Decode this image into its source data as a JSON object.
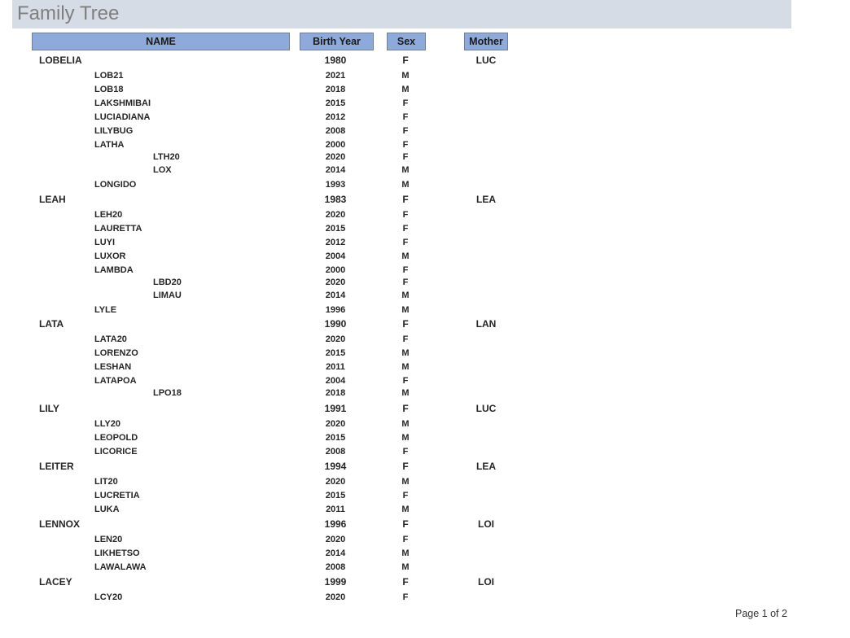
{
  "title": "Family Tree",
  "headers": {
    "name": "NAME",
    "birth_year": "Birth Year",
    "sex": "Sex",
    "mother": "Mother"
  },
  "rows": [
    {
      "level": 0,
      "name": "LOBELIA",
      "year": "1980",
      "sex": "F",
      "mother": "LUC"
    },
    {
      "level": 1,
      "name": "LOB21",
      "year": "2021",
      "sex": "M"
    },
    {
      "level": 1,
      "name": "LOB18",
      "year": "2018",
      "sex": "M"
    },
    {
      "level": 1,
      "name": "LAKSHMIBAI",
      "year": "2015",
      "sex": "F"
    },
    {
      "level": 1,
      "name": "LUCIADIANA",
      "year": "2012",
      "sex": "F"
    },
    {
      "level": 1,
      "name": "LILYBUG",
      "year": "2008",
      "sex": "F"
    },
    {
      "level": 1,
      "name": "LATHA",
      "year": "2000",
      "sex": "F"
    },
    {
      "level": 2,
      "name": "LTH20",
      "year": "2020",
      "sex": "F"
    },
    {
      "level": 2,
      "name": "LOX",
      "year": "2014",
      "sex": "M"
    },
    {
      "level": 1,
      "name": "LONGIDO",
      "year": "1993",
      "sex": "M"
    },
    {
      "level": 0,
      "name": "LEAH",
      "year": "1983",
      "sex": "F",
      "mother": "LEA"
    },
    {
      "level": 1,
      "name": "LEH20",
      "year": "2020",
      "sex": "F"
    },
    {
      "level": 1,
      "name": "LAURETTA",
      "year": "2015",
      "sex": "F"
    },
    {
      "level": 1,
      "name": "LUYI",
      "year": "2012",
      "sex": "F"
    },
    {
      "level": 1,
      "name": "LUXOR",
      "year": "2004",
      "sex": "M"
    },
    {
      "level": 1,
      "name": "LAMBDA",
      "year": "2000",
      "sex": "F"
    },
    {
      "level": 2,
      "name": "LBD20",
      "year": "2020",
      "sex": "F"
    },
    {
      "level": 2,
      "name": "LIMAU",
      "year": "2014",
      "sex": "M"
    },
    {
      "level": 1,
      "name": "LYLE",
      "year": "1996",
      "sex": "M"
    },
    {
      "level": 0,
      "name": "LATA",
      "year": "1990",
      "sex": "F",
      "mother": "LAN"
    },
    {
      "level": 1,
      "name": "LATA20",
      "year": "2020",
      "sex": "F"
    },
    {
      "level": 1,
      "name": "LORENZO",
      "year": "2015",
      "sex": "M"
    },
    {
      "level": 1,
      "name": "LESHAN",
      "year": "2011",
      "sex": "M"
    },
    {
      "level": 1,
      "name": "LATAPOA",
      "year": "2004",
      "sex": "F"
    },
    {
      "level": 2,
      "name": "LPO18",
      "year": "2018",
      "sex": "M"
    },
    {
      "level": 0,
      "name": "LILY",
      "year": "1991",
      "sex": "F",
      "mother": "LUC"
    },
    {
      "level": 1,
      "name": "LLY20",
      "year": "2020",
      "sex": "M"
    },
    {
      "level": 1,
      "name": "LEOPOLD",
      "year": "2015",
      "sex": "M"
    },
    {
      "level": 1,
      "name": "LICORICE",
      "year": "2008",
      "sex": "F"
    },
    {
      "level": 0,
      "name": "LEITER",
      "year": "1994",
      "sex": "F",
      "mother": "LEA"
    },
    {
      "level": 1,
      "name": "LIT20",
      "year": "2020",
      "sex": "M"
    },
    {
      "level": 1,
      "name": "LUCRETIA",
      "year": "2015",
      "sex": "F"
    },
    {
      "level": 1,
      "name": "LUKA",
      "year": "2011",
      "sex": "M"
    },
    {
      "level": 0,
      "name": "LENNOX",
      "year": "1996",
      "sex": "F",
      "mother": "LOI"
    },
    {
      "level": 1,
      "name": "LEN20",
      "year": "2020",
      "sex": "F"
    },
    {
      "level": 1,
      "name": "LIKHETSO",
      "year": "2014",
      "sex": "M"
    },
    {
      "level": 1,
      "name": "LAWALAWA",
      "year": "2008",
      "sex": "M"
    },
    {
      "level": 0,
      "name": "LACEY",
      "year": "1999",
      "sex": "F",
      "mother": "LOI"
    },
    {
      "level": 1,
      "name": "LCY20",
      "year": "2020",
      "sex": "F"
    }
  ],
  "footer": {
    "page": "Page 1 of 2"
  }
}
